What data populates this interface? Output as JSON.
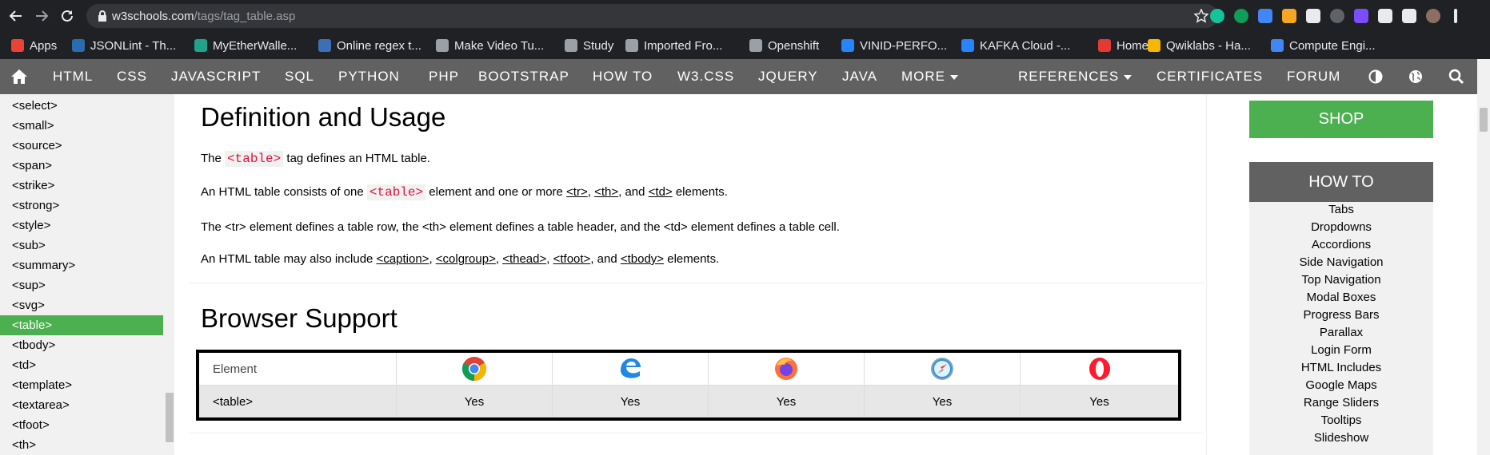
{
  "browser": {
    "url_host": "w3schools.com",
    "url_path": "/tags/tag_table.asp",
    "bookmarks": [
      {
        "label": "Apps",
        "color": "#ea4335"
      },
      {
        "label": "JSONLint - Th...",
        "color": "#2b6cb0"
      },
      {
        "label": "MyEtherWalle...",
        "color": "#1fa38a"
      },
      {
        "label": "Online regex t...",
        "color": "#3b6fb6"
      },
      {
        "label": "Make Video Tu...",
        "color": "#9aa0a6"
      },
      {
        "label": "Study",
        "color": "#9aa0a6"
      },
      {
        "label": "Imported Fro...",
        "color": "#9aa0a6"
      },
      {
        "label": "Openshift",
        "color": "#9aa0a6"
      },
      {
        "label": "VINID-PERFO...",
        "color": "#2684ff"
      },
      {
        "label": "KAFKA Cloud -...",
        "color": "#2684ff"
      },
      {
        "label": "Home",
        "color": "#e53935"
      },
      {
        "label": "Qwiklabs - Ha...",
        "color": "#f5b700"
      },
      {
        "label": "Compute Engi...",
        "color": "#4285f4"
      }
    ]
  },
  "nav": {
    "items": [
      "HTML",
      "CSS",
      "JAVASCRIPT",
      "SQL",
      "PYTHON",
      "PHP",
      "BOOTSTRAP",
      "HOW TO",
      "W3.CSS",
      "JQUERY",
      "JAVA",
      "MORE"
    ],
    "right": [
      "REFERENCES",
      "CERTIFICATES",
      "FORUM"
    ]
  },
  "sidebar": {
    "items": [
      "<select>",
      "<small>",
      "<source>",
      "<span>",
      "<strike>",
      "<strong>",
      "<style>",
      "<sub>",
      "<summary>",
      "<sup>",
      "<svg>",
      "<table>",
      "<tbody>",
      "<td>",
      "<template>",
      "<textarea>",
      "<tfoot>",
      "<th>"
    ],
    "active": "<table>"
  },
  "main": {
    "title1": "Definition and Usage",
    "p1": {
      "a": "The ",
      "code": "<table>",
      "b": " tag defines an HTML table."
    },
    "p2": {
      "a": "An HTML table consists of one ",
      "code": "<table>",
      "b": " element and one or more ",
      "l1": "<tr>",
      "c": ", ",
      "l2": "<th>",
      "d": ", and ",
      "l3": "<td>",
      "e": " elements."
    },
    "p3": "The <tr> element defines a table row, the <th> element defines a table header, and the <td> element defines a table cell.",
    "p4": {
      "a": "An HTML table may also include ",
      "l1": "<caption>",
      "s1": ", ",
      "l2": "<colgroup>",
      "s2": ", ",
      "l3": "<thead>",
      "s3": ", ",
      "l4": "<tfoot>",
      "s4": ", and ",
      "l5": "<tbody>",
      "e": " elements."
    },
    "title2": "Browser Support",
    "table": {
      "header": "Element",
      "browsers": [
        "chrome-icon",
        "edge-icon",
        "firefox-icon",
        "safari-icon",
        "opera-icon"
      ],
      "row_label": "<table>",
      "values": [
        "Yes",
        "Yes",
        "Yes",
        "Yes",
        "Yes"
      ]
    }
  },
  "right": {
    "shop": "SHOP",
    "howto_title": "HOW TO",
    "howto_links": [
      "Tabs",
      "Dropdowns",
      "Accordions",
      "Side Navigation",
      "Top Navigation",
      "Modal Boxes",
      "Progress Bars",
      "Parallax",
      "Login Form",
      "HTML Includes",
      "Google Maps",
      "Range Sliders",
      "Tooltips",
      "Slideshow"
    ]
  }
}
